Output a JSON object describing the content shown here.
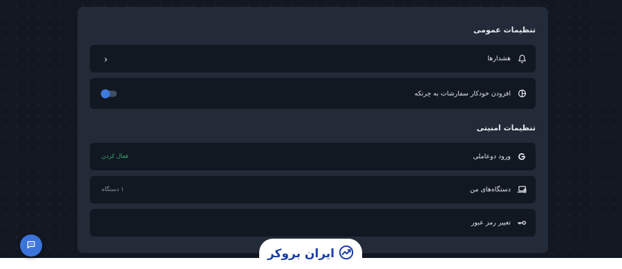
{
  "general_settings": {
    "title": "تنظیمات عمومی",
    "alerts": {
      "label": "هشدارها",
      "icon": "bell-icon"
    },
    "auto_add_orders": {
      "label": "افزودن خودکار سفارشات به چرتکه",
      "icon": "pie-chart-icon",
      "toggle_on": true
    }
  },
  "security_settings": {
    "title": "تنظیمات امنیتی",
    "two_factor": {
      "label": "ورود دوعاملی",
      "action": "فعال کردن",
      "icon": "google-icon"
    },
    "my_devices": {
      "label": "دستگاه‌های من",
      "value": "۱ دستگاه",
      "icon": "devices-icon"
    },
    "change_password": {
      "label": "تغییر رمز عبور",
      "icon": "key-icon"
    }
  },
  "footer": {
    "logo_text": "ایران بروکر"
  },
  "colors": {
    "accent": "#3b74da",
    "success": "#3ea86b",
    "panel": "#222b37",
    "row": "#121822"
  }
}
